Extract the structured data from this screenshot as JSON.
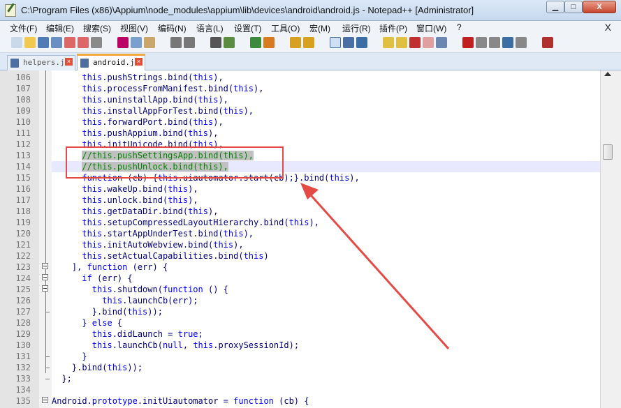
{
  "window": {
    "title": "C:\\Program Files (x86)\\Appium\\node_modules\\appium\\lib\\devices\\android\\android.js - Notepad++ [Administrator]",
    "min_label": "▁",
    "max_label": "□",
    "close_label": "X"
  },
  "menu": {
    "items": [
      "文件(F)",
      "编辑(E)",
      "搜索(S)",
      "视图(V)",
      "编码(N)",
      "语言(L)",
      "设置(T)",
      "工具(O)",
      "宏(M)",
      "运行(R)",
      "插件(P)",
      "窗口(W)",
      "?"
    ],
    "close_label": "X"
  },
  "tabs": [
    {
      "label": "helpers.js",
      "active": false
    },
    {
      "label": "android.js",
      "active": true
    }
  ],
  "tab_close_label": "×",
  "toolbar_icons": [
    "new-file-icon",
    "open-file-icon",
    "save-icon",
    "save-all-icon",
    "close-icon",
    "close-all-icon",
    "print-icon",
    "cut-icon",
    "copy-icon",
    "paste-icon",
    "undo-icon",
    "redo-icon",
    "find-icon",
    "replace-icon",
    "zoom-in-icon",
    "zoom-out-icon",
    "sync-v-icon",
    "sync-h-icon",
    "wrap-icon",
    "show-all-chars-icon",
    "indent-guide-icon",
    "udl-icon",
    "doc-map-icon",
    "function-list-icon",
    "folder-workspace-icon",
    "monitor-icon",
    "record-macro-icon",
    "stop-macro-icon",
    "play-macro-icon",
    "run-macro-multiple-icon",
    "save-macro-icon",
    "spellcheck-icon"
  ],
  "code": {
    "lines": [
      {
        "n": "106",
        "segs": [
          [
            "      ",
            ""
          ],
          [
            "this",
            "kw"
          ],
          [
            ".pushStrings.bind(",
            ""
          ],
          [
            "this",
            "kw"
          ],
          [
            "),",
            ""
          ]
        ]
      },
      {
        "n": "107",
        "segs": [
          [
            "      ",
            ""
          ],
          [
            "this",
            "kw"
          ],
          [
            ".processFromManifest.bind(",
            ""
          ],
          [
            "this",
            "kw"
          ],
          [
            "),",
            ""
          ]
        ]
      },
      {
        "n": "108",
        "segs": [
          [
            "      ",
            ""
          ],
          [
            "this",
            "kw"
          ],
          [
            ".uninstallApp.bind(",
            ""
          ],
          [
            "this",
            "kw"
          ],
          [
            "),",
            ""
          ]
        ]
      },
      {
        "n": "109",
        "segs": [
          [
            "      ",
            ""
          ],
          [
            "this",
            "kw"
          ],
          [
            ".installAppForTest.bind(",
            ""
          ],
          [
            "this",
            "kw"
          ],
          [
            "),",
            ""
          ]
        ]
      },
      {
        "n": "110",
        "segs": [
          [
            "      ",
            ""
          ],
          [
            "this",
            "kw"
          ],
          [
            ".forwardPort.bind(",
            ""
          ],
          [
            "this",
            "kw"
          ],
          [
            "),",
            ""
          ]
        ]
      },
      {
        "n": "111",
        "segs": [
          [
            "      ",
            ""
          ],
          [
            "this",
            "kw"
          ],
          [
            ".pushAppium.bind(",
            ""
          ],
          [
            "this",
            "kw"
          ],
          [
            "),",
            ""
          ]
        ]
      },
      {
        "n": "112",
        "segs": [
          [
            "      ",
            ""
          ],
          [
            "this",
            "kw"
          ],
          [
            ".initUnicode.bind(",
            ""
          ],
          [
            "this",
            "kw"
          ],
          [
            "),",
            ""
          ]
        ]
      },
      {
        "n": "113",
        "segs": [
          [
            "      ",
            ""
          ],
          [
            "//this.pushSettingsApp.bind(this),",
            "cm"
          ]
        ]
      },
      {
        "n": "114",
        "segs": [
          [
            "      ",
            ""
          ],
          [
            "//this.pushUnlock.bind(this),",
            "cm"
          ]
        ]
      },
      {
        "n": "115",
        "segs": [
          [
            "      ",
            ""
          ],
          [
            "function",
            "kw"
          ],
          [
            " (cb) {",
            ""
          ],
          [
            "this",
            "kw"
          ],
          [
            ".uiautomator.start(cb);}.bind(",
            ""
          ],
          [
            "this",
            "kw"
          ],
          [
            "),",
            ""
          ]
        ]
      },
      {
        "n": "116",
        "segs": [
          [
            "      ",
            ""
          ],
          [
            "this",
            "kw"
          ],
          [
            ".wakeUp.bind(",
            ""
          ],
          [
            "this",
            "kw"
          ],
          [
            "),",
            ""
          ]
        ]
      },
      {
        "n": "117",
        "segs": [
          [
            "      ",
            ""
          ],
          [
            "this",
            "kw"
          ],
          [
            ".unlock.bind(",
            ""
          ],
          [
            "this",
            "kw"
          ],
          [
            "),",
            ""
          ]
        ]
      },
      {
        "n": "118",
        "segs": [
          [
            "      ",
            ""
          ],
          [
            "this",
            "kw"
          ],
          [
            ".getDataDir.bind(",
            ""
          ],
          [
            "this",
            "kw"
          ],
          [
            "),",
            ""
          ]
        ]
      },
      {
        "n": "119",
        "segs": [
          [
            "      ",
            ""
          ],
          [
            "this",
            "kw"
          ],
          [
            ".setupCompressedLayoutHierarchy.bind(",
            ""
          ],
          [
            "this",
            "kw"
          ],
          [
            "),",
            ""
          ]
        ]
      },
      {
        "n": "120",
        "segs": [
          [
            "      ",
            ""
          ],
          [
            "this",
            "kw"
          ],
          [
            ".startAppUnderTest.bind(",
            ""
          ],
          [
            "this",
            "kw"
          ],
          [
            "),",
            ""
          ]
        ]
      },
      {
        "n": "121",
        "segs": [
          [
            "      ",
            ""
          ],
          [
            "this",
            "kw"
          ],
          [
            ".initAutoWebview.bind(",
            ""
          ],
          [
            "this",
            "kw"
          ],
          [
            "),",
            ""
          ]
        ]
      },
      {
        "n": "122",
        "segs": [
          [
            "      ",
            ""
          ],
          [
            "this",
            "kw"
          ],
          [
            ".setActualCapabilities.bind(",
            ""
          ],
          [
            "this",
            "kw"
          ],
          [
            ")",
            ""
          ]
        ]
      },
      {
        "n": "123",
        "segs": [
          [
            "    ], ",
            ""
          ],
          [
            "function",
            "kw"
          ],
          [
            " (err) {",
            ""
          ]
        ]
      },
      {
        "n": "124",
        "segs": [
          [
            "      ",
            ""
          ],
          [
            "if",
            "kw"
          ],
          [
            " (err) {",
            ""
          ]
        ]
      },
      {
        "n": "125",
        "segs": [
          [
            "        ",
            ""
          ],
          [
            "this",
            "kw"
          ],
          [
            ".shutdown(",
            ""
          ],
          [
            "function",
            "kw"
          ],
          [
            " () {",
            ""
          ]
        ]
      },
      {
        "n": "126",
        "segs": [
          [
            "          ",
            ""
          ],
          [
            "this",
            "kw"
          ],
          [
            ".launchCb(err);",
            ""
          ]
        ]
      },
      {
        "n": "127",
        "segs": [
          [
            "        }.bind(",
            ""
          ],
          [
            "this",
            "kw"
          ],
          [
            "));",
            ""
          ]
        ]
      },
      {
        "n": "128",
        "segs": [
          [
            "      } ",
            ""
          ],
          [
            "else",
            "kw"
          ],
          [
            " {",
            ""
          ]
        ]
      },
      {
        "n": "129",
        "segs": [
          [
            "        ",
            ""
          ],
          [
            "this",
            "kw"
          ],
          [
            ".didLaunch = ",
            ""
          ],
          [
            "true",
            "kw"
          ],
          [
            ";",
            ""
          ]
        ]
      },
      {
        "n": "130",
        "segs": [
          [
            "        ",
            ""
          ],
          [
            "this",
            "kw"
          ],
          [
            ".launchCb(",
            ""
          ],
          [
            "null",
            "kw"
          ],
          [
            ", ",
            ""
          ],
          [
            "this",
            "kw"
          ],
          [
            ".proxySessionId);",
            ""
          ]
        ]
      },
      {
        "n": "131",
        "segs": [
          [
            "      }",
            ""
          ]
        ]
      },
      {
        "n": "132",
        "segs": [
          [
            "    }.bind(",
            ""
          ],
          [
            "this",
            "kw"
          ],
          [
            "));",
            ""
          ]
        ]
      },
      {
        "n": "133",
        "segs": [
          [
            "  };",
            ""
          ]
        ]
      },
      {
        "n": "134",
        "segs": [
          [
            "",
            ""
          ]
        ]
      },
      {
        "n": "135",
        "segs": [
          [
            "Android.",
            ""
          ],
          [
            "prototype",
            "kw"
          ],
          [
            ".initUiautomator = ",
            ""
          ],
          [
            "function",
            "kw"
          ],
          [
            " (cb) {",
            ""
          ]
        ]
      }
    ],
    "current_line": "114"
  },
  "colors": {
    "keyword": "#0000ff",
    "identifier": "#000080",
    "comment": "#008000",
    "annotation": "#e54a44"
  }
}
